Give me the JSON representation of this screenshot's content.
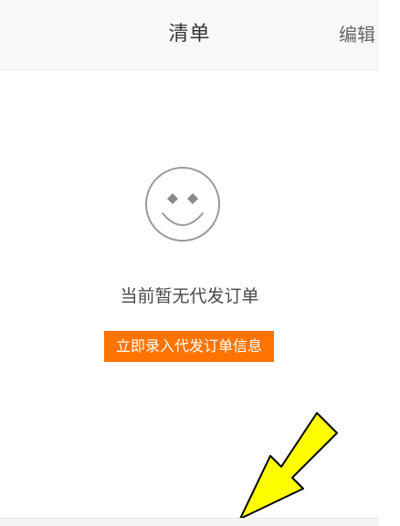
{
  "header": {
    "title": "清单",
    "edit_label": "编辑"
  },
  "empty_state": {
    "icon": "smiley-face-icon",
    "message": "当前暂无代发订单",
    "action_label": "立即录入代发订单信息"
  },
  "annotation": {
    "icon": "yellow-arrow-icon"
  },
  "colors": {
    "accent": "#ff7300",
    "header_bg": "#f8f8f8",
    "arrow": "#ffff00"
  }
}
